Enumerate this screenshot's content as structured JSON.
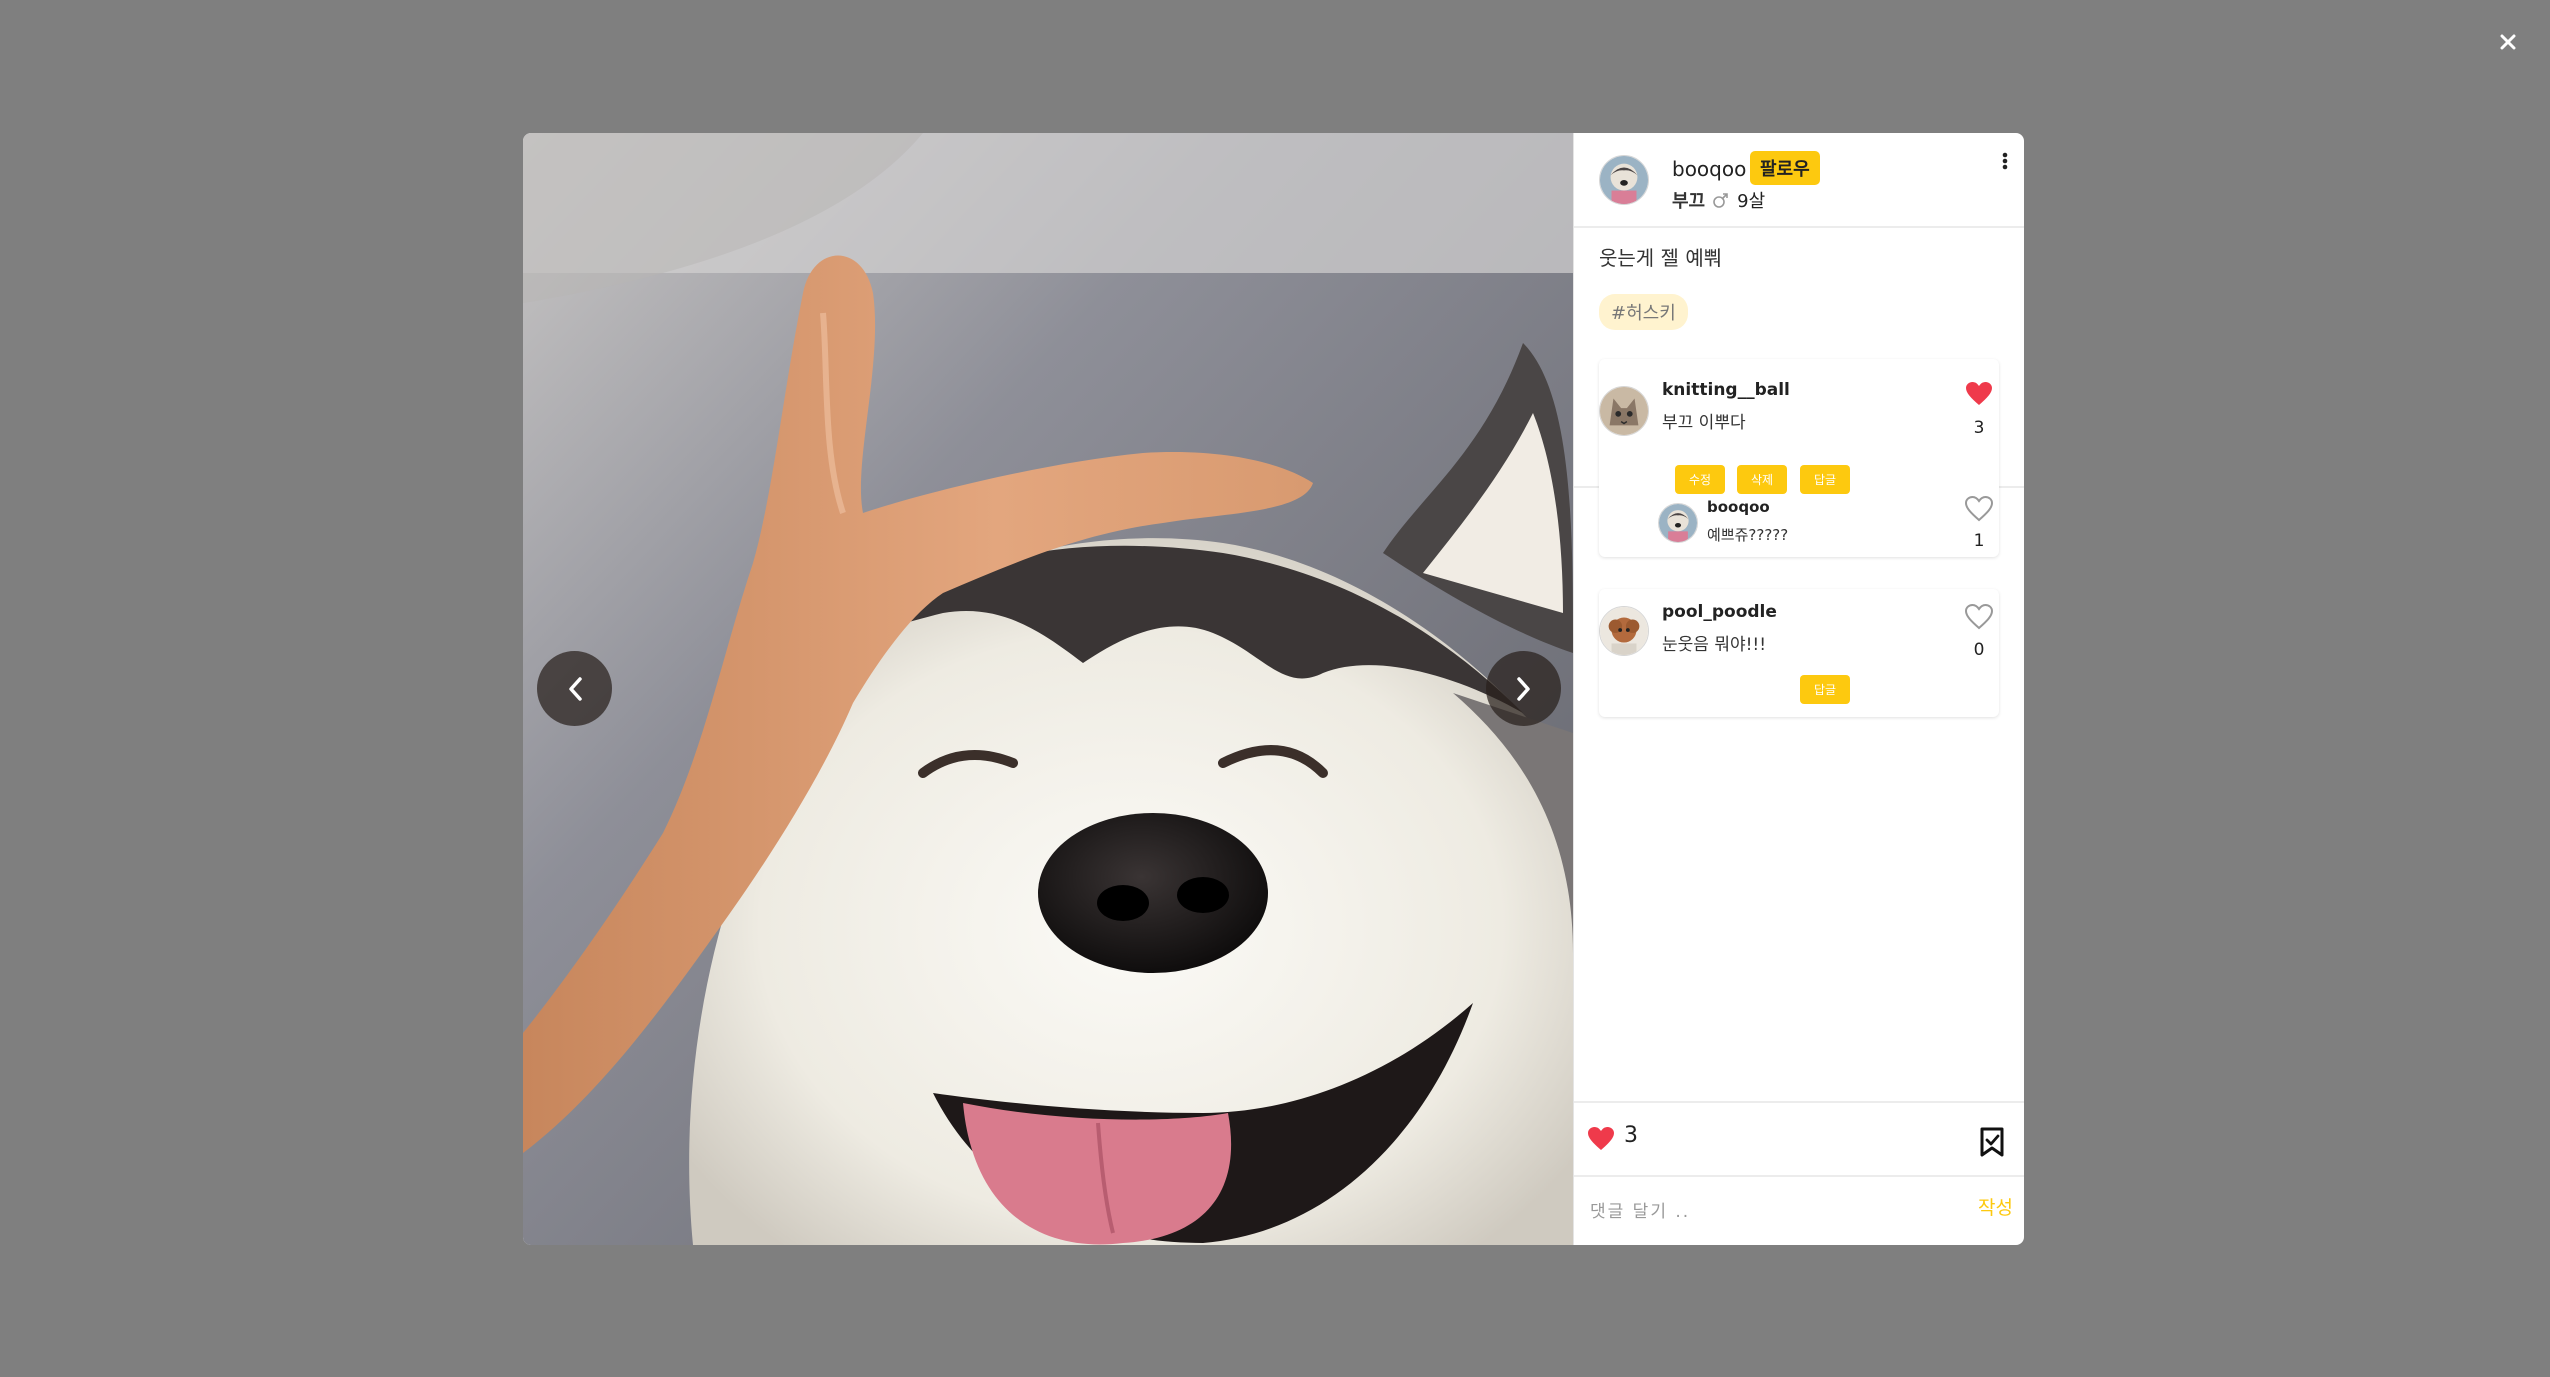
{
  "post": {
    "author": "booqoo",
    "follow_label": "팔로우",
    "pet_name": "부끄",
    "pet_age": "9살",
    "caption": "웃는게 젤 예뿨",
    "hashtag": "#허스키",
    "total_likes": "3",
    "liked": true
  },
  "comments": [
    {
      "user": "knitting__ball",
      "text": "부끄 이뿌다",
      "likes": "3",
      "liked": true,
      "actions": {
        "edit": "수정",
        "delete": "삭제",
        "reply": "답글"
      },
      "replies": [
        {
          "user": "booqoo",
          "text": "예쁘쥬?????",
          "likes": "1",
          "liked": false
        }
      ]
    },
    {
      "user": "pool_poodle",
      "text": "눈웃음 뭐야!!!",
      "likes": "0",
      "liked": false,
      "actions": {
        "reply": "답글"
      }
    }
  ],
  "composer": {
    "placeholder": "댓글 달기 ..",
    "submit_label": "작성"
  },
  "icons": {
    "close": "close-icon",
    "prev": "chevron-left-icon",
    "next": "chevron-right-icon",
    "more": "more-vertical-icon",
    "gender": "male-icon",
    "heart": "heart-icon",
    "bookmark": "bookmark-icon"
  },
  "colors": {
    "accent": "#fdc90f",
    "heart": "#ef3a4b",
    "overlay": "#7f7f7f"
  }
}
